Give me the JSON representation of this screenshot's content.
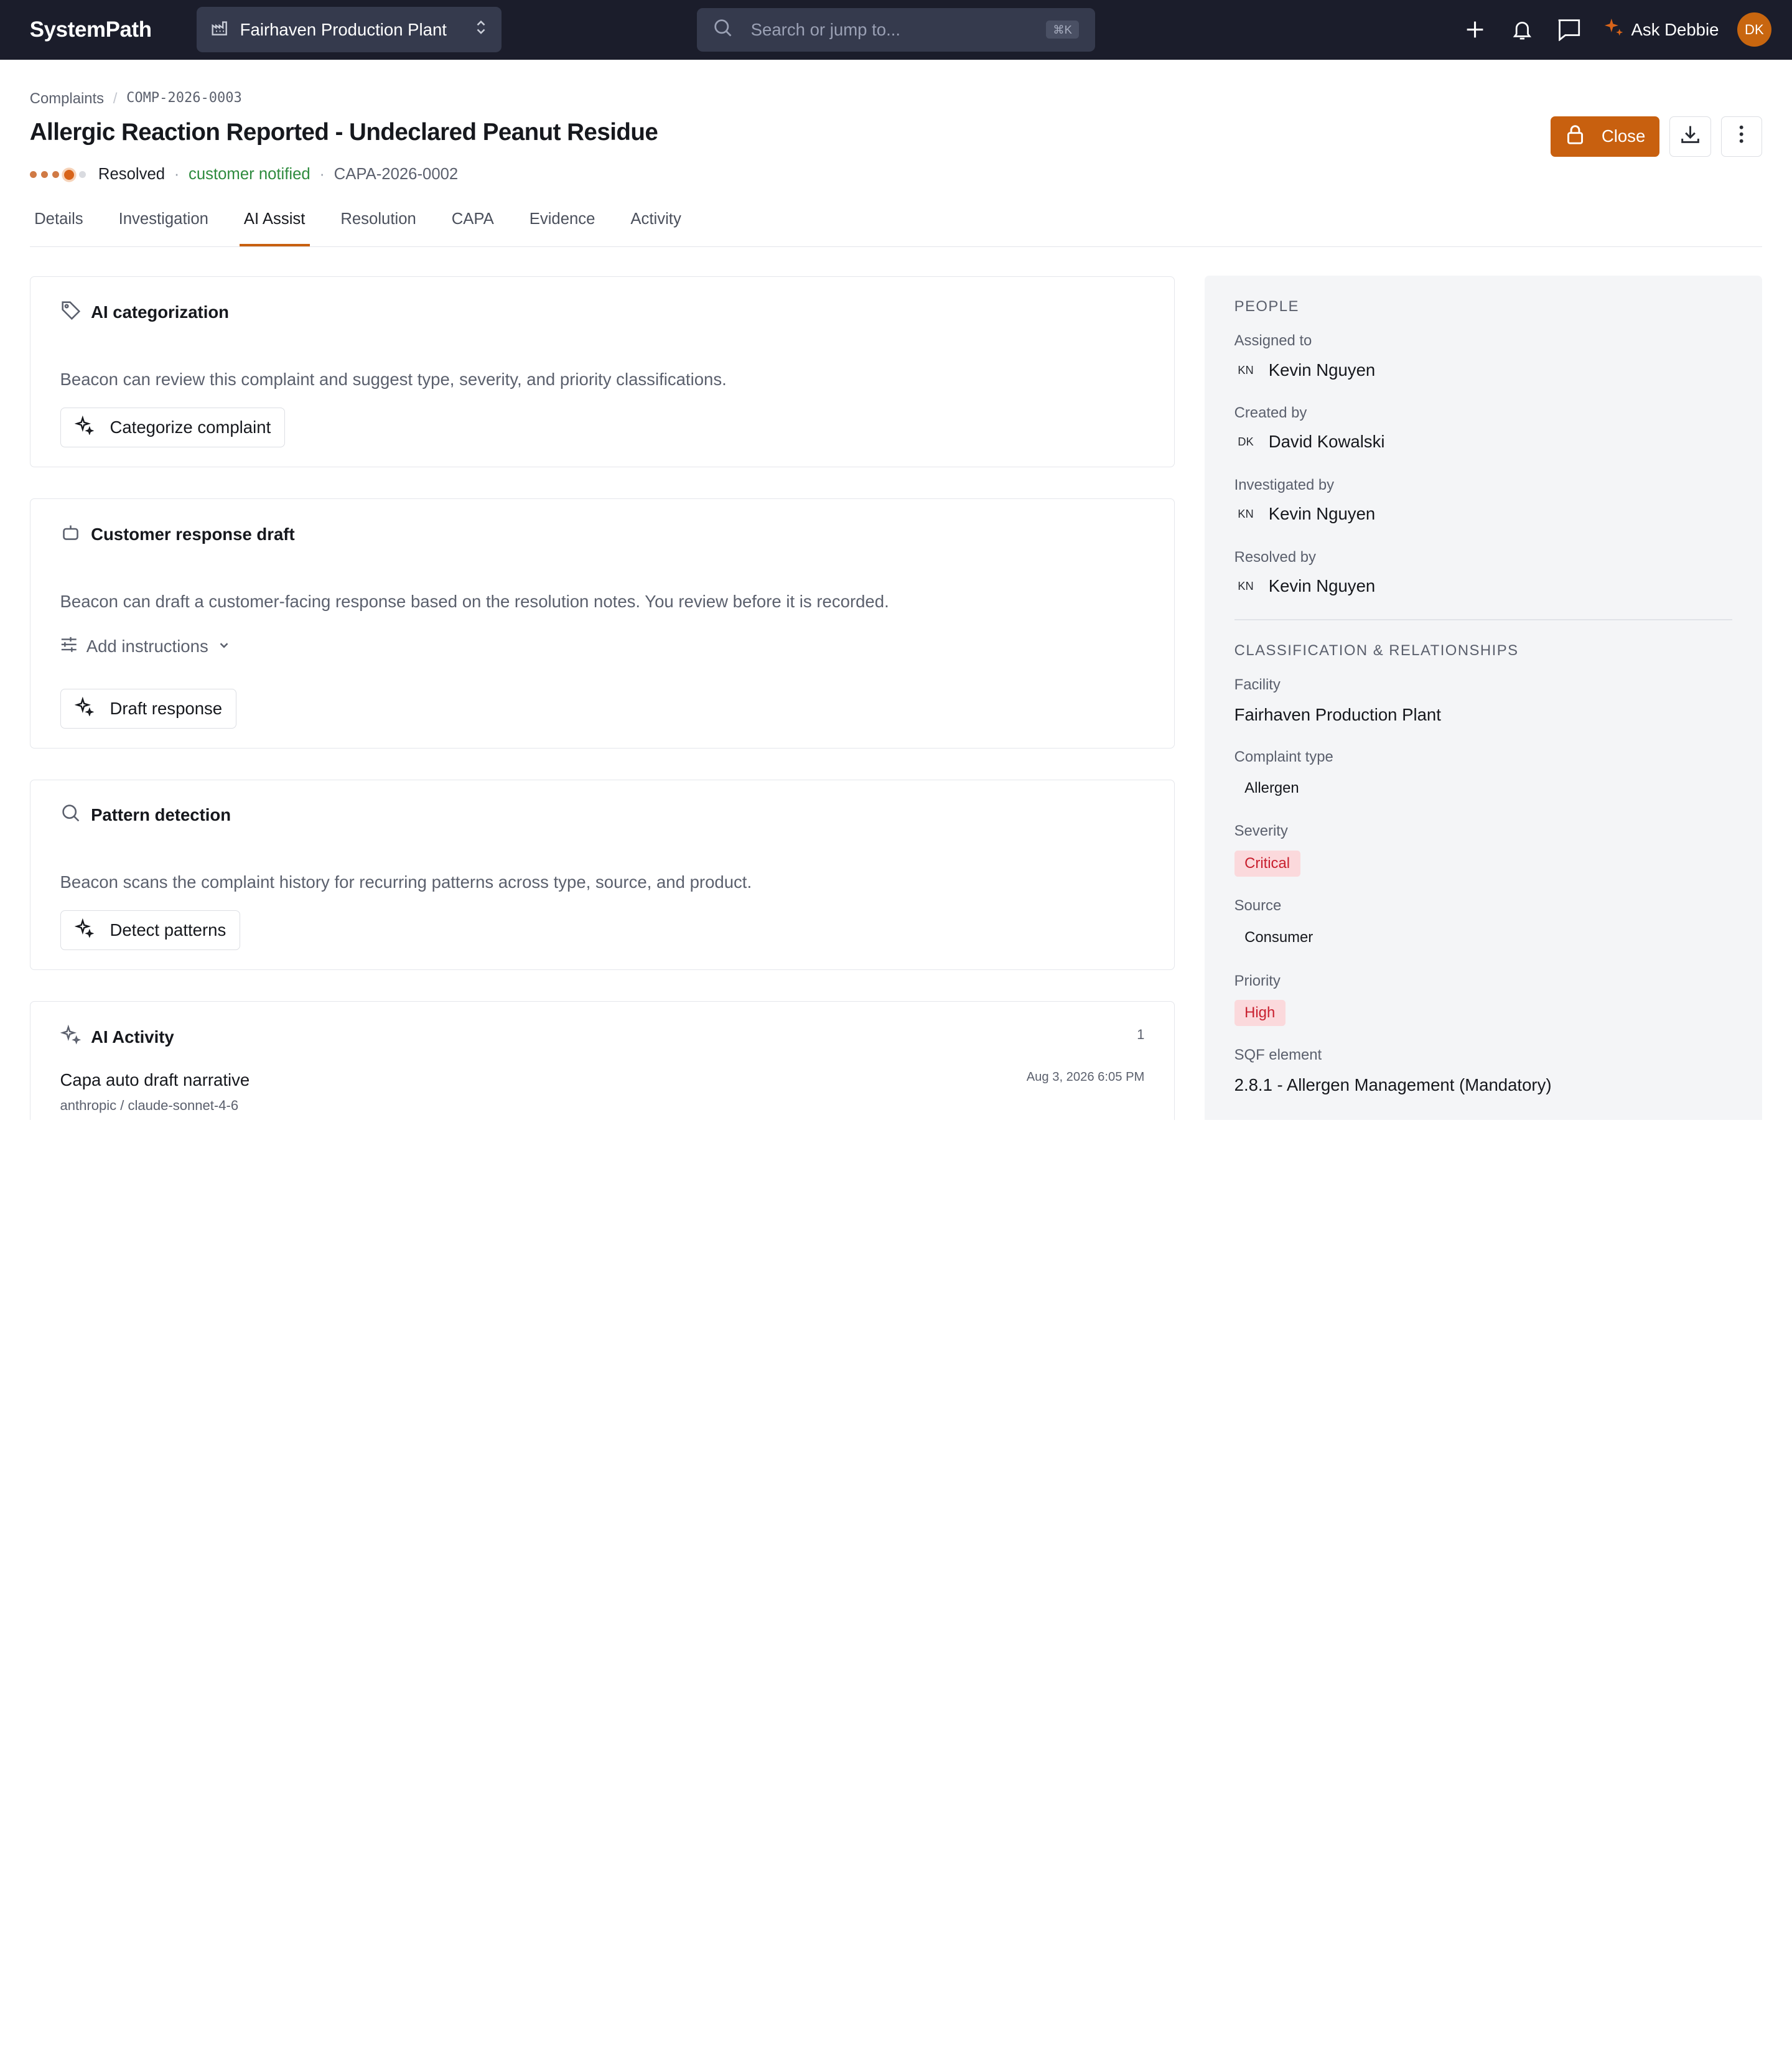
{
  "app": {
    "brand": "SystemPath"
  },
  "topbar": {
    "plant": "Fairhaven Production Plant",
    "search_placeholder": "Search or jump to...",
    "search_shortcut": "⌘K",
    "ask_label": "Ask Debbie",
    "avatar_initials": "DK",
    "icons": [
      "plus-icon",
      "bell-icon",
      "chat-icon",
      "sparkle-icon"
    ]
  },
  "breadcrumb": {
    "root": "Complaints",
    "sep": "/",
    "id": "COMP-2026-0003"
  },
  "header": {
    "title": "Allergic Reaction Reported - Undeclared Peanut Residue",
    "status": "Resolved",
    "sep": "·",
    "customer_status": "customer notified",
    "capa_ref": "CAPA-2026-0002",
    "close_label": "Close",
    "progress": {
      "completed_steps": 3,
      "current_step": 4,
      "total_steps": 5
    }
  },
  "tabs": [
    {
      "label": "Details"
    },
    {
      "label": "Investigation"
    },
    {
      "label": "AI Assist",
      "active": true
    },
    {
      "label": "Resolution"
    },
    {
      "label": "CAPA"
    },
    {
      "label": "Evidence"
    },
    {
      "label": "Activity"
    }
  ],
  "cards": {
    "categorization": {
      "title": "AI categorization",
      "description": "Beacon can review this complaint and suggest type, severity, and priority classifications.",
      "button": "Categorize complaint"
    },
    "response": {
      "title": "Customer response draft",
      "description": "Beacon can draft a customer-facing response based on the resolution notes. You review before it is recorded.",
      "instructions_toggle": "Add instructions",
      "button": "Draft response"
    },
    "patterns": {
      "title": "Pattern detection",
      "description": "Beacon scans the complaint history for recurring patterns across type, source, and product.",
      "button": "Detect patterns"
    },
    "activity": {
      "title": "AI Activity",
      "count": "1",
      "item_title": "Capa auto draft narrative",
      "item_model": "anthropic / claude-sonnet-4-6",
      "item_time": "Aug 3, 2026 6:05 PM"
    }
  },
  "side": {
    "people_heading": "PEOPLE",
    "assigned_label": "Assigned to",
    "assigned_initials": "KN",
    "assigned_name": "Kevin Nguyen",
    "created_label": "Created by",
    "created_initials": "DK",
    "created_name": "David Kowalski",
    "investigated_label": "Investigated by",
    "investigated_initials": "KN",
    "investigated_name": "Kevin Nguyen",
    "resolved_label": "Resolved by",
    "resolved_initials": "KN",
    "resolved_name": "Kevin Nguyen",
    "class_heading": "CLASSIFICATION & RELATIONSHIPS",
    "facility_label": "Facility",
    "facility_value": "Fairhaven Production Plant",
    "type_label": "Complaint type",
    "type_value": "Allergen",
    "severity_label": "Severity",
    "severity_value": "Critical",
    "source_label": "Source",
    "source_value": "Consumer",
    "priority_label": "Priority",
    "priority_value": "High",
    "sqf_label": "SQF element",
    "sqf_value": "2.8.1 - Allergen Management (Mandatory)"
  },
  "colors": {
    "topbar": "#1b1d2b",
    "accent": "#c8600f",
    "notified_green": "#2e8b3e",
    "critical_pill_bg": "#fbd9dc",
    "critical_pill_text": "#c81f2e"
  }
}
